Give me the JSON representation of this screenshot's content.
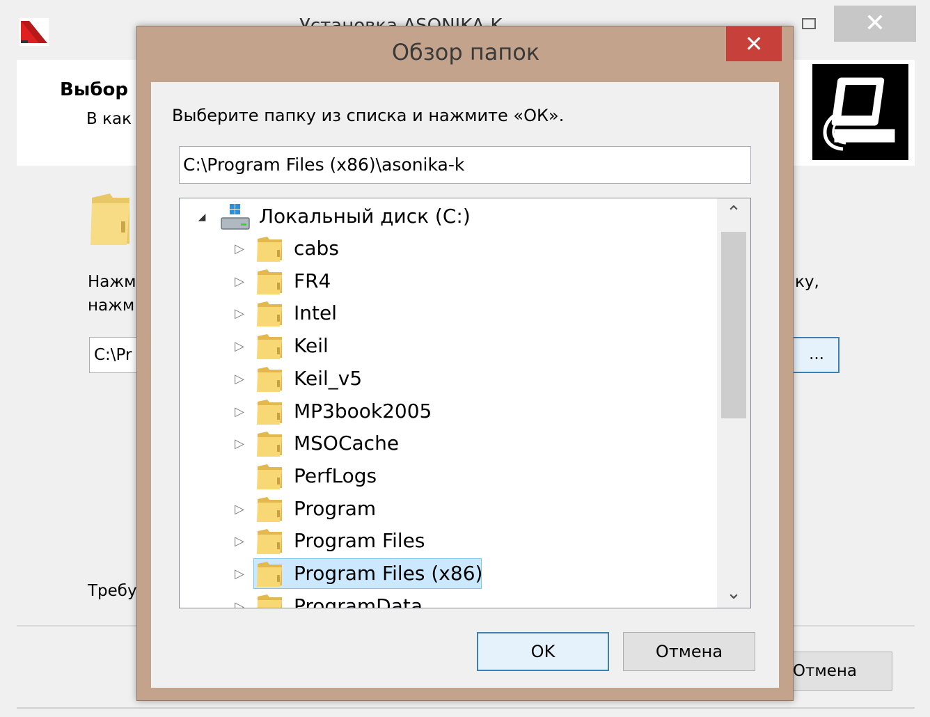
{
  "colors": {
    "dialog_frame": "#c3a38b",
    "close_button": "#c7403a",
    "selection_fill": "#cce8ff",
    "selection_border": "#7ac6f5",
    "default_button_border": "#3c7fb1"
  },
  "background_window": {
    "title_visible": "Установка ASONIKA-K",
    "header": {
      "title_visible": "Выбор",
      "subtitle_visible": "В как"
    },
    "body": {
      "info_line1_visible": "Нажм",
      "info_line2_visible": "нажм",
      "info_right_visible": "ку,",
      "path_visible": "C:\\Pr",
      "browse_label_visible": "...",
      "space_visible": "Требу"
    },
    "footer": {
      "cancel_visible": "Отмена"
    }
  },
  "dialog": {
    "title": "Обзор папок",
    "close_glyph": "✕",
    "instruction": "Выберите папку из списка и нажмите «ОК».",
    "path_value": "C:\\Program Files (x86)\\asonika-k",
    "tree": {
      "root": {
        "label": "Локальный диск (C:)",
        "icon": "drive-icon",
        "expanded": true
      },
      "items": [
        {
          "label": "cabs",
          "has_children": true,
          "selected": false
        },
        {
          "label": "FR4",
          "has_children": true,
          "selected": false
        },
        {
          "label": "Intel",
          "has_children": true,
          "selected": false
        },
        {
          "label": "Keil",
          "has_children": true,
          "selected": false
        },
        {
          "label": "Keil_v5",
          "has_children": true,
          "selected": false
        },
        {
          "label": "MP3book2005",
          "has_children": true,
          "selected": false
        },
        {
          "label": "MSOCache",
          "has_children": true,
          "selected": false
        },
        {
          "label": "PerfLogs",
          "has_children": false,
          "selected": false
        },
        {
          "label": "Program",
          "has_children": true,
          "selected": false
        },
        {
          "label": "Program Files",
          "has_children": true,
          "selected": false
        },
        {
          "label": "Program Files (x86)",
          "has_children": true,
          "selected": true
        },
        {
          "label": "ProgramData",
          "has_children": true,
          "selected": false
        }
      ]
    },
    "ok_label": "OK",
    "cancel_label": "Отмена"
  }
}
